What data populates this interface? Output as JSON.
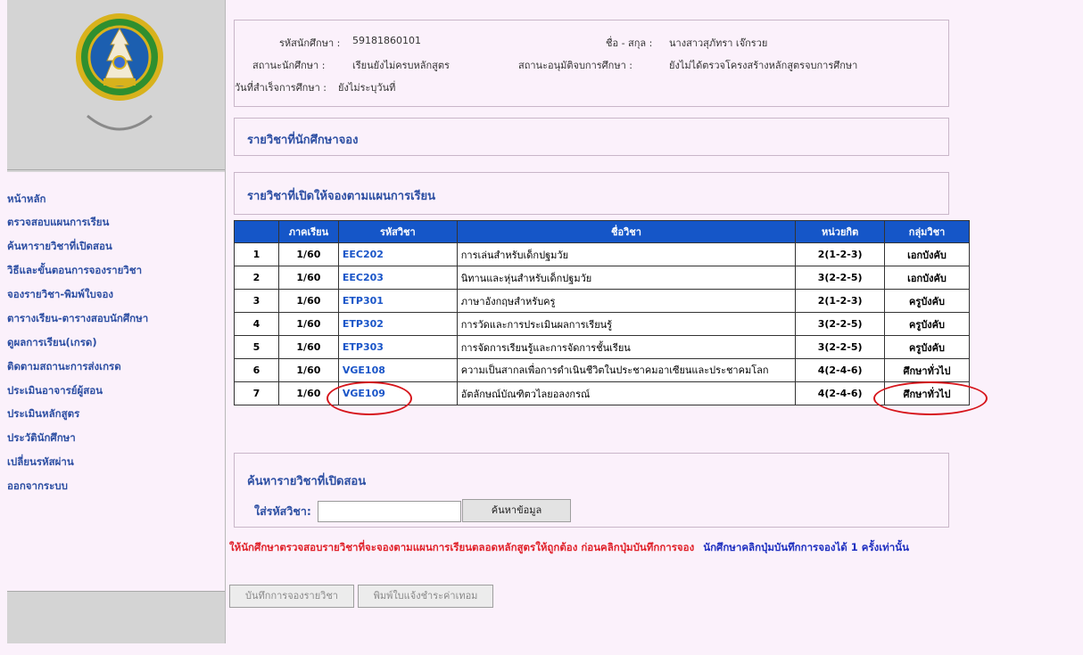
{
  "sidebar": {
    "logo_caption": "",
    "items": [
      {
        "label": "หน้าหลัก"
      },
      {
        "label": "ตรวจสอบแผนการเรียน"
      },
      {
        "label": "ค้นหารายวิชาที่เปิดสอน"
      },
      {
        "label": "วิธีและขั้นตอนการจองรายวิชา"
      },
      {
        "label": "จองรายวิชา-พิมพ์ใบจอง"
      },
      {
        "label": "ตารางเรียน-ตารางสอบนักศึกษา"
      },
      {
        "label": "ดูผลการเรียน(เกรด)"
      },
      {
        "label": "ติดตามสถานะการส่งเกรด"
      },
      {
        "label": "ประเมินอาจารย์ผู้สอน"
      },
      {
        "label": "ประเมินหลักสูตร"
      },
      {
        "label": "ประวัตินักศึกษา"
      },
      {
        "label": "เปลี่ยนรหัสผ่าน"
      },
      {
        "label": "ออกจากระบบ"
      }
    ]
  },
  "student": {
    "id_label": "รหัสนักศึกษา :",
    "id": "59181860101",
    "name_label": "ชื่อ - สกุล :",
    "name": "นางสาวสุภัทรา เจ๊กรวย",
    "status_label": "สถานะนักศึกษา :",
    "status": "เรียนยังไม่ครบหลักสูตร",
    "approval_label": "สถานะอนุมัติจบการศึกษา :",
    "approval": "ยังไม่ได้ตรวจโครงสร้างหลักสูตรจบการศึกษา",
    "grad_date_label": "วันที่สำเร็จการศึกษา :",
    "grad_date": "ยังไม่ระบุวันที่"
  },
  "sections": {
    "reserved_title": "รายวิชาที่นักศึกษาจอง",
    "open_title": "รายวิชาที่เปิดให้จองตามแผนการเรียน",
    "search_title": "ค้นหารายวิชาที่เปิดสอน"
  },
  "table": {
    "headers": [
      "",
      "ภาคเรียน",
      "รหัสวิชา",
      "ชื่อวิชา",
      "หน่วยกิต",
      "กลุ่มวิชา"
    ],
    "rows": [
      {
        "no": "1",
        "term": "1/60",
        "code": "EEC202",
        "name": "การเล่นสำหรับเด็กปฐมวัย",
        "credit": "2(1-2-3)",
        "group": "เอกบังคับ"
      },
      {
        "no": "2",
        "term": "1/60",
        "code": "EEC203",
        "name": "นิทานและหุ่นสำหรับเด็กปฐมวัย",
        "credit": "3(2-2-5)",
        "group": "เอกบังคับ"
      },
      {
        "no": "3",
        "term": "1/60",
        "code": "ETP301",
        "name": "ภาษาอังกฤษสำหรับครู",
        "credit": "2(1-2-3)",
        "group": "ครูบังคับ"
      },
      {
        "no": "4",
        "term": "1/60",
        "code": "ETP302",
        "name": "การวัดและการประเมินผลการเรียนรู้",
        "credit": "3(2-2-5)",
        "group": "ครูบังคับ"
      },
      {
        "no": "5",
        "term": "1/60",
        "code": "ETP303",
        "name": "การจัดการเรียนรู้และการจัดการชั้นเรียน",
        "credit": "3(2-2-5)",
        "group": "ครูบังคับ"
      },
      {
        "no": "6",
        "term": "1/60",
        "code": "VGE108",
        "name": "ความเป็นสากลเพื่อการดำเนินชีวิตในประชาคมอาเซียนและประชาคมโลก",
        "credit": "4(2-4-6)",
        "group": "ศึกษาทั่วไป"
      },
      {
        "no": "7",
        "term": "1/60",
        "code": "VGE109",
        "name": "อัตลักษณ์บัณฑิตวไลยอลงกรณ์",
        "credit": "4(2-4-6)",
        "group": "ศึกษาทั่วไป"
      }
    ]
  },
  "search": {
    "label": "ใส่รหัสวิชา:",
    "value": "",
    "button": "ค้นหาข้อมูล"
  },
  "warning": {
    "red_text": "ให้นักศึกษาตรวจสอบรายวิชาที่จะจองตามแผนการเรียนตลอดหลักสูตรให้ถูกต้อง ก่อนคลิกปุ่มบันทึกการจอง",
    "blue_text": "นักศึกษาคลิกปุ่มบันทึกการจองได้ 1 ครั้งเท่านั้น",
    "red_color": "#e0212a",
    "blue_color": "#1e2fc0"
  },
  "actions": {
    "save_button": "บันทึกการจองรายวิชา",
    "print_button": "พิมพ์ใบแจ้งชำระค่าเทอม"
  },
  "colors": {
    "header_blue": "#1556c8",
    "link_blue": "#2d4fa3",
    "annotation_red": "#d6151b"
  }
}
